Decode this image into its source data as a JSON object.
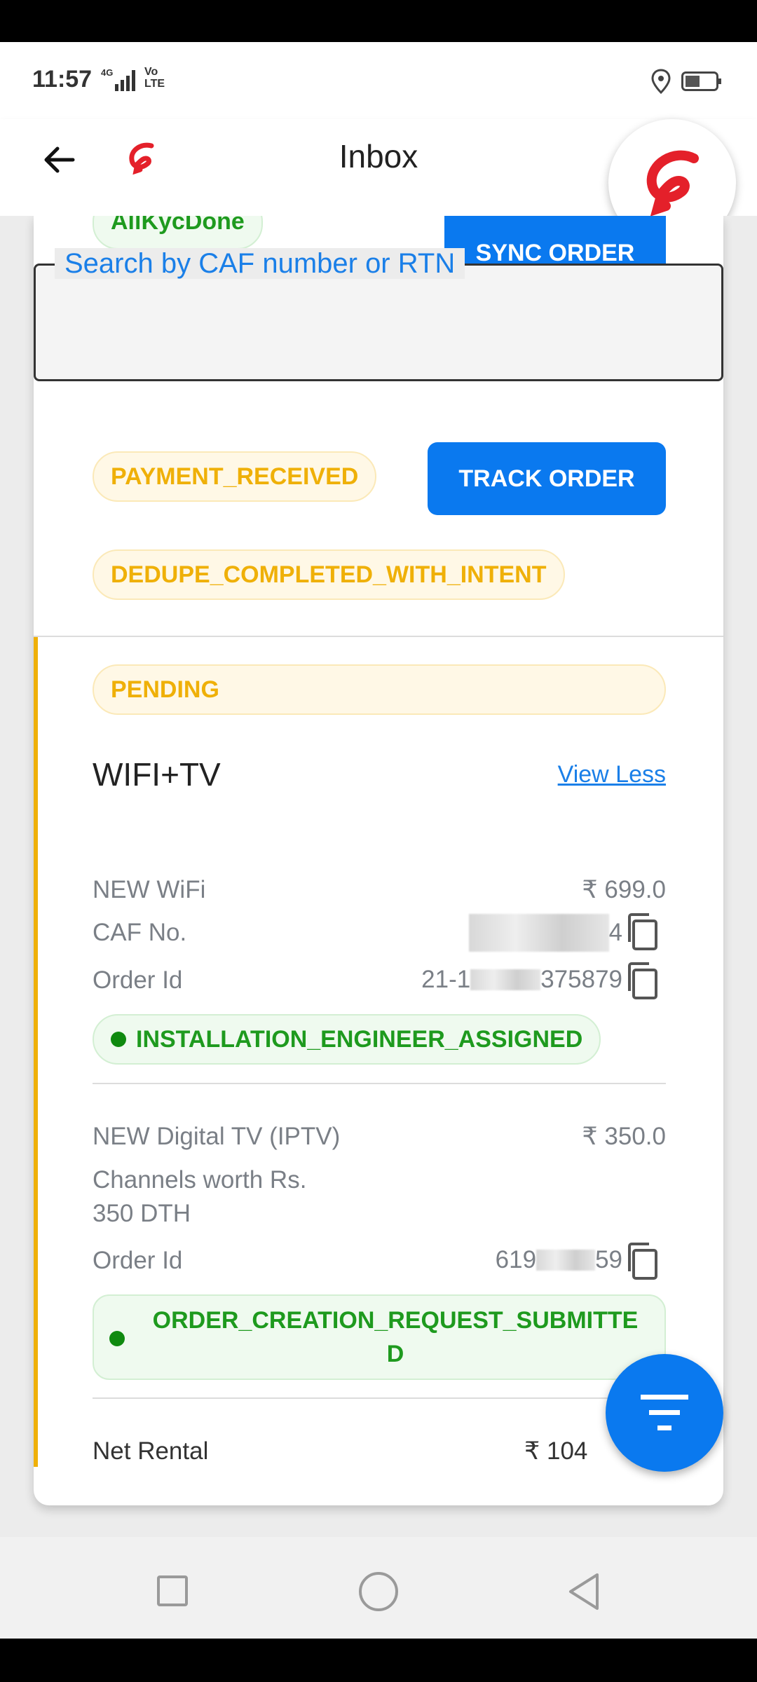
{
  "status_bar": {
    "time": "11:57",
    "network": "4G",
    "volte": "Vo LTE"
  },
  "app_bar": {
    "title": "Inbox"
  },
  "search": {
    "label": "Search by CAF number or RTN",
    "value": ""
  },
  "order_top": {
    "badges": [
      "AllKycDone",
      "PAYMENT_RECEIVED",
      "DEDUPE_COMPLETED_WITH_INTENT"
    ],
    "sync_button": "SYNC ORDER",
    "track_button": "TRACK ORDER"
  },
  "order_main": {
    "status": "PENDING",
    "title": "WIFI+TV",
    "toggle_link": "View Less",
    "wifi": {
      "name": "NEW WiFi",
      "price": "₹ 699.0",
      "caf_label": "CAF No.",
      "caf_suffix": "4",
      "order_label": "Order Id",
      "order_prefix": "21-1",
      "order_suffix": "375879",
      "state": "INSTALLATION_ENGINEER_ASSIGNED"
    },
    "tv": {
      "name": "NEW Digital TV (IPTV)",
      "price": "₹ 350.0",
      "desc_line1": "Channels worth Rs.",
      "desc_line2": "350 DTH",
      "order_label": "Order Id",
      "order_prefix": "619",
      "order_suffix": "59",
      "state_line1": "ORDER_CREATION_REQUEST_SUBMITTE",
      "state_line2": "D"
    },
    "net_rental_label": "Net Rental",
    "net_rental_value": "₹ 104"
  },
  "colors": {
    "accent_blue": "#0a79ef",
    "pending_yellow": "#efb008",
    "status_green": "#1e9a1e",
    "airtel_red": "#e4202a"
  }
}
